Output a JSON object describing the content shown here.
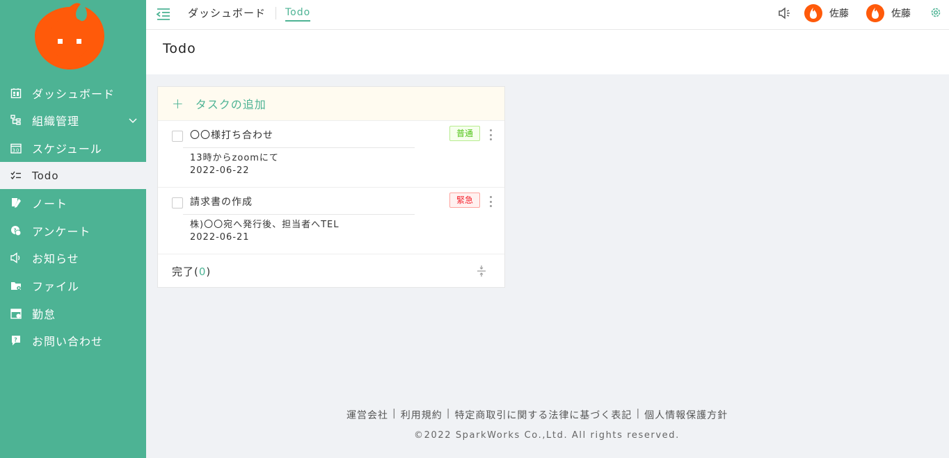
{
  "sidebar": {
    "items": [
      {
        "label": "ダッシュボード",
        "icon": "dashboard-icon"
      },
      {
        "label": "組織管理",
        "icon": "org-chart-icon"
      },
      {
        "label": "スケジュール",
        "icon": "calendar-icon"
      },
      {
        "label": "Todo",
        "icon": "checklist-icon"
      },
      {
        "label": "ノート",
        "icon": "note-icon"
      },
      {
        "label": "アンケート",
        "icon": "survey-icon"
      },
      {
        "label": "お知らせ",
        "icon": "megaphone-icon"
      },
      {
        "label": "ファイル",
        "icon": "folder-icon"
      },
      {
        "label": "勤怠",
        "icon": "attendance-icon"
      },
      {
        "label": "お問い合わせ",
        "icon": "inquiry-icon"
      }
    ],
    "active_index": 3
  },
  "header": {
    "breadcrumb_home": "ダッシュボード",
    "breadcrumb_current": "Todo",
    "users": [
      {
        "name": "佐藤"
      },
      {
        "name": "佐藤"
      }
    ]
  },
  "page": {
    "title": "Todo"
  },
  "todo": {
    "add_label": "タスクの追加",
    "add_icon": "+",
    "tasks": [
      {
        "title": "〇〇様打ち合わせ",
        "memo": "13時からzoomにて",
        "date": "2022-06-22",
        "priority": "普通"
      },
      {
        "title": "請求書の作成",
        "memo": "株)〇〇宛へ発行後、担当者へTEL",
        "date": "2022-06-21",
        "priority": "緊急"
      }
    ],
    "done_label": "完了",
    "done_count": "0"
  },
  "footer": {
    "links": [
      "運営会社",
      "利用規約",
      "特定商取引に関する法律に基づく表記",
      "個人情報保護方針"
    ],
    "separator": "|",
    "copyright": "©2022 SparkWorks Co.,Ltd. All rights reserved."
  },
  "colors": {
    "brand": "#4db394",
    "logo": "#ff5a0a",
    "tag_normal": "#52c41a",
    "tag_urgent": "#f5222d"
  }
}
